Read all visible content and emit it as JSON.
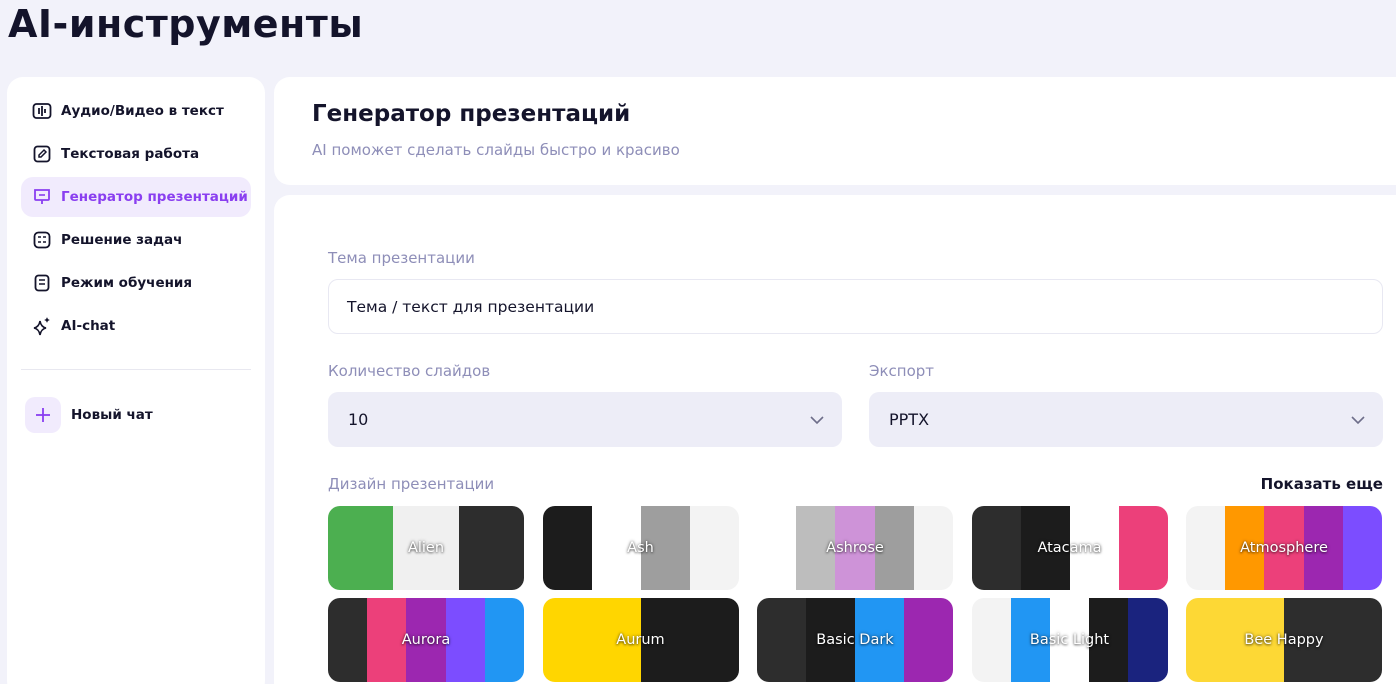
{
  "app_title": "AI-инструменты",
  "sidebar": {
    "items": [
      {
        "label": "Аудио/Видео в текст",
        "icon": "audio-icon",
        "active": false
      },
      {
        "label": "Текстовая работа",
        "icon": "edit-document-icon",
        "active": false
      },
      {
        "label": "Генератор презентаций",
        "icon": "presentation-icon",
        "active": true
      },
      {
        "label": "Решение задач",
        "icon": "calculator-icon",
        "active": false
      },
      {
        "label": "Режим обучения",
        "icon": "book-icon",
        "active": false
      },
      {
        "label": "AI-chat",
        "icon": "sparkle-icon",
        "active": false
      }
    ],
    "new_chat_label": "Новый чат"
  },
  "header": {
    "title": "Генератор презентаций",
    "subtitle": "AI поможет сделать слайды быстро и красиво"
  },
  "form": {
    "topic_label": "Тема презентации",
    "topic_value": "Тема / текст для презентации",
    "slides_label": "Количество слайдов",
    "slides_value": "10",
    "export_label": "Экспорт",
    "export_value": "PPTX",
    "design_label": "Дизайн презентации",
    "show_more_label": "Показать еще"
  },
  "designs": [
    {
      "name": "Alien",
      "colors": [
        "#4caf50",
        "#f0f0f0",
        "#2d2d2d"
      ]
    },
    {
      "name": "Ash",
      "colors": [
        "#1c1c1c",
        "#ffffff",
        "#9e9e9e",
        "#f3f3f3"
      ]
    },
    {
      "name": "Ashrose",
      "colors": [
        "#ffffff",
        "#bdbdbd",
        "#ce93d8",
        "#9e9e9e",
        "#f3f3f3"
      ]
    },
    {
      "name": "Atacama",
      "colors": [
        "#2d2d2d",
        "#1c1c1c",
        "#ffffff",
        "#ec407a"
      ]
    },
    {
      "name": "Atmosphere",
      "colors": [
        "#f3f3f3",
        "#ff9800",
        "#ec407a",
        "#9c27b0",
        "#7c4dff"
      ]
    },
    {
      "name": "Aurora",
      "colors": [
        "#2d2d2d",
        "#ec407a",
        "#9c27b0",
        "#7c4dff",
        "#2196f3"
      ]
    },
    {
      "name": "Aurum",
      "colors": [
        "#ffd600",
        "#1c1c1c"
      ]
    },
    {
      "name": "Basic Dark",
      "colors": [
        "#2d2d2d",
        "#1c1c1c",
        "#2196f3",
        "#9c27b0"
      ]
    },
    {
      "name": "Basic Light",
      "colors": [
        "#f3f3f3",
        "#2196f3",
        "#ffffff",
        "#1c1c1c",
        "#1a237e"
      ]
    },
    {
      "name": "Bee Happy",
      "colors": [
        "#fdd835",
        "#2d2d2d"
      ]
    }
  ],
  "accent_color": "#8a3ff0"
}
